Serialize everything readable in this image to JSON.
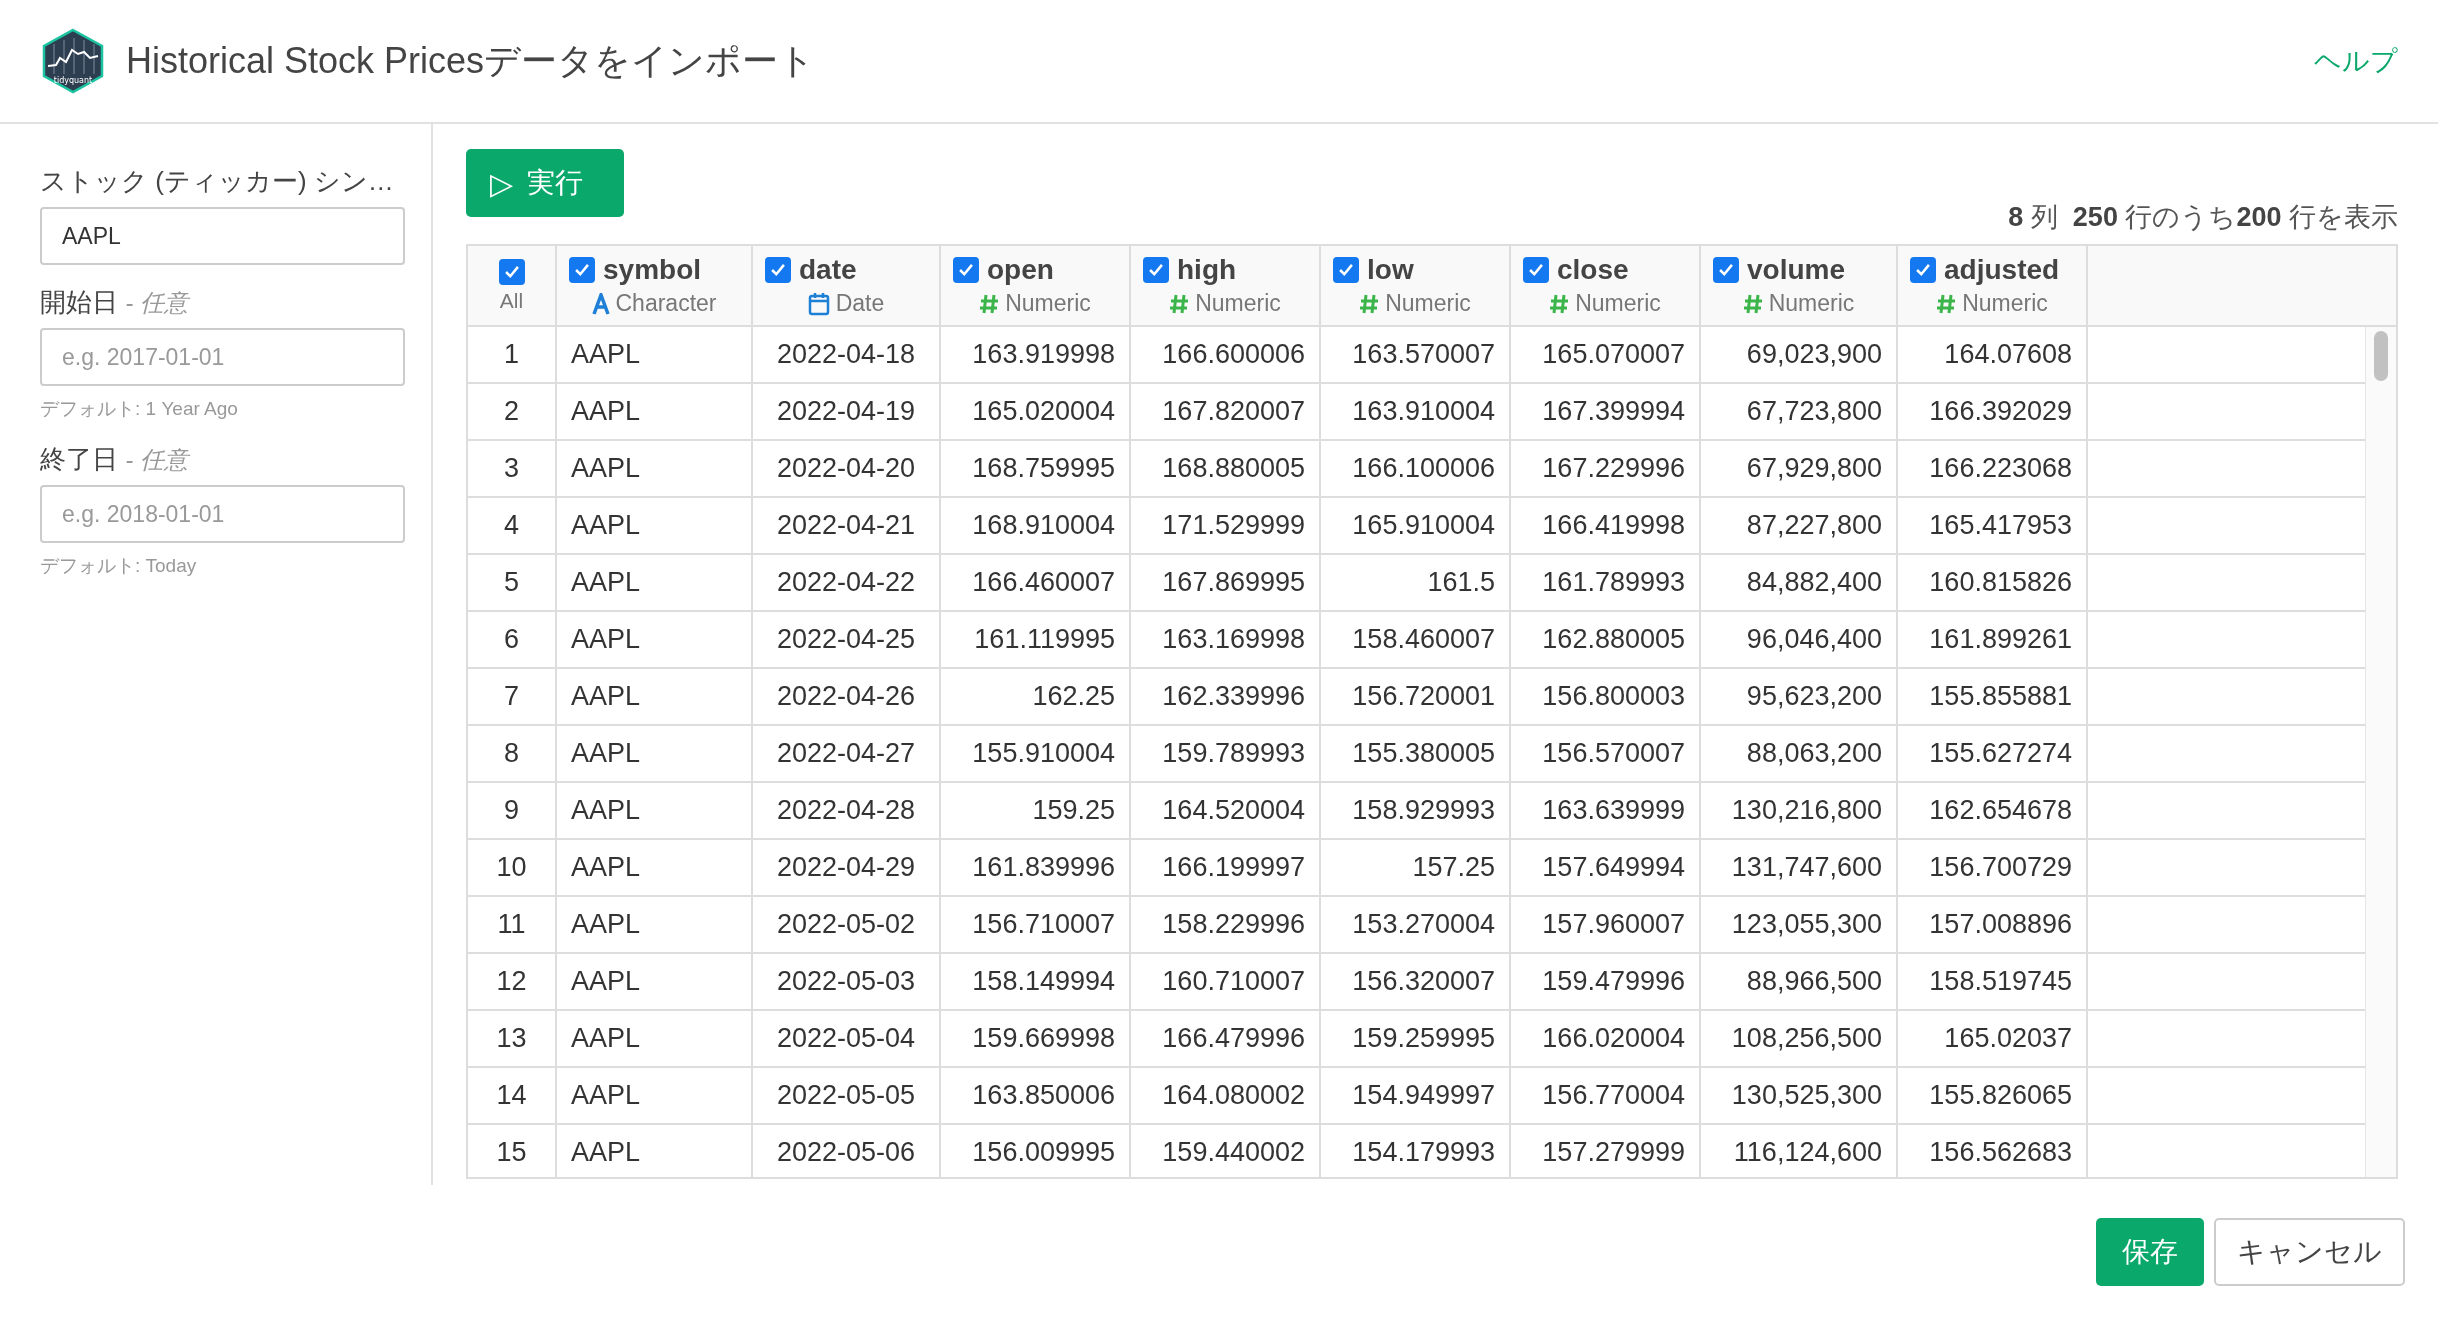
{
  "header": {
    "logo_text": "tidyquant",
    "title": "Historical Stock Pricesデータをインポート",
    "help_link": "ヘルプ"
  },
  "sidebar": {
    "fields": [
      {
        "label": "ストック (ティッカー) シン…",
        "value": "AAPL"
      },
      {
        "label": "開始日",
        "optional": "- 任意",
        "placeholder": "e.g. 2017-01-01",
        "hint": "デフォルト: 1 Year Ago"
      },
      {
        "label": "終了日",
        "optional": "- 任意",
        "placeholder": "e.g. 2018-01-01",
        "hint": "デフォルト: Today"
      }
    ]
  },
  "run_button": {
    "icon": "▷",
    "label": "実行"
  },
  "status": "**8** 列  **250** 行のうち**200** 行を表示",
  "table": {
    "columns": [
      {
        "name": "All",
        "kind": "all",
        "checked": true
      },
      {
        "name": "symbol",
        "kind": "character",
        "type": "Character",
        "checked": true
      },
      {
        "name": "date",
        "kind": "date",
        "type": "Date",
        "checked": true
      },
      {
        "name": "open",
        "kind": "numeric",
        "type": "Numeric",
        "checked": true
      },
      {
        "name": "high",
        "kind": "numeric",
        "type": "Numeric",
        "checked": true
      },
      {
        "name": "low",
        "kind": "numeric",
        "type": "Numeric",
        "checked": true
      },
      {
        "name": "close",
        "kind": "numeric",
        "type": "Numeric",
        "checked": true
      },
      {
        "name": "volume",
        "kind": "numeric",
        "type": "Numeric",
        "checked": true
      },
      {
        "name": "adjusted",
        "kind": "numeric",
        "type": "Numeric",
        "checked": true
      }
    ],
    "rows": [
      [
        "1",
        "AAPL",
        "2022-04-18",
        "163.919998",
        "166.600006",
        "163.570007",
        "165.070007",
        "69,023,900",
        "164.07608"
      ],
      [
        "2",
        "AAPL",
        "2022-04-19",
        "165.020004",
        "167.820007",
        "163.910004",
        "167.399994",
        "67,723,800",
        "166.392029"
      ],
      [
        "3",
        "AAPL",
        "2022-04-20",
        "168.759995",
        "168.880005",
        "166.100006",
        "167.229996",
        "67,929,800",
        "166.223068"
      ],
      [
        "4",
        "AAPL",
        "2022-04-21",
        "168.910004",
        "171.529999",
        "165.910004",
        "166.419998",
        "87,227,800",
        "165.417953"
      ],
      [
        "5",
        "AAPL",
        "2022-04-22",
        "166.460007",
        "167.869995",
        "161.5",
        "161.789993",
        "84,882,400",
        "160.815826"
      ],
      [
        "6",
        "AAPL",
        "2022-04-25",
        "161.119995",
        "163.169998",
        "158.460007",
        "162.880005",
        "96,046,400",
        "161.899261"
      ],
      [
        "7",
        "AAPL",
        "2022-04-26",
        "162.25",
        "162.339996",
        "156.720001",
        "156.800003",
        "95,623,200",
        "155.855881"
      ],
      [
        "8",
        "AAPL",
        "2022-04-27",
        "155.910004",
        "159.789993",
        "155.380005",
        "156.570007",
        "88,063,200",
        "155.627274"
      ],
      [
        "9",
        "AAPL",
        "2022-04-28",
        "159.25",
        "164.520004",
        "158.929993",
        "163.639999",
        "130,216,800",
        "162.654678"
      ],
      [
        "10",
        "AAPL",
        "2022-04-29",
        "161.839996",
        "166.199997",
        "157.25",
        "157.649994",
        "131,747,600",
        "156.700729"
      ],
      [
        "11",
        "AAPL",
        "2022-05-02",
        "156.710007",
        "158.229996",
        "153.270004",
        "157.960007",
        "123,055,300",
        "157.008896"
      ],
      [
        "12",
        "AAPL",
        "2022-05-03",
        "158.149994",
        "160.710007",
        "156.320007",
        "159.479996",
        "88,966,500",
        "158.519745"
      ],
      [
        "13",
        "AAPL",
        "2022-05-04",
        "159.669998",
        "166.479996",
        "159.259995",
        "166.020004",
        "108,256,500",
        "165.02037"
      ],
      [
        "14",
        "AAPL",
        "2022-05-05",
        "163.850006",
        "164.080002",
        "154.949997",
        "156.770004",
        "130,525,300",
        "155.826065"
      ],
      [
        "15",
        "AAPL",
        "2022-05-06",
        "156.009995",
        "159.440002",
        "154.179993",
        "157.279999",
        "116,124,600",
        "156.562683"
      ]
    ]
  },
  "footer": {
    "save": "保存",
    "cancel": "キャンセル"
  }
}
